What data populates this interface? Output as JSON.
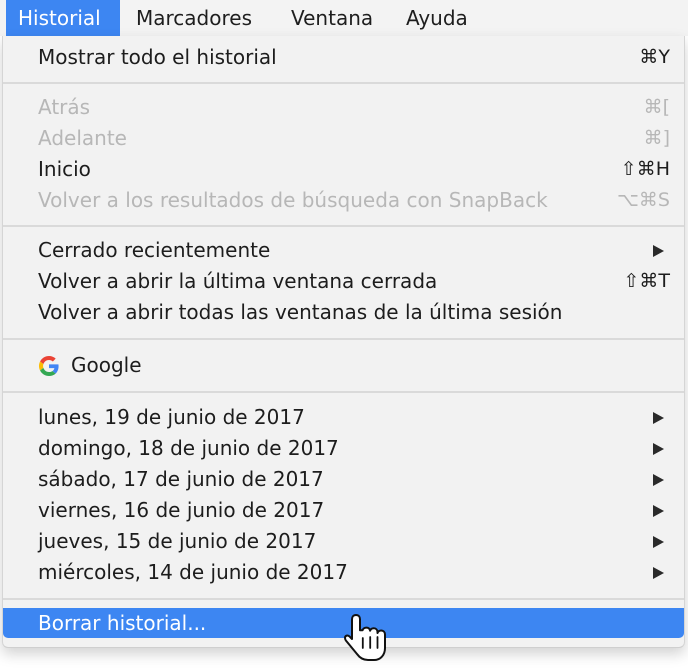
{
  "menubar": {
    "items": [
      "Historial",
      "Marcadores",
      "Ventana",
      "Ayuda"
    ]
  },
  "menu": {
    "show_all": {
      "label": "Mostrar todo el historial",
      "shortcut": "⌘Y"
    },
    "nav": [
      {
        "label": "Atrás",
        "shortcut": "⌘["
      },
      {
        "label": "Adelante",
        "shortcut": "⌘]"
      },
      {
        "label": "Inicio",
        "shortcut": "⇧⌘H"
      },
      {
        "label": "Volver a los resultados de búsqueda con SnapBack",
        "shortcut": "⌥⌘S"
      }
    ],
    "recent": {
      "recently_closed": "Cerrado recientemente",
      "reopen_last_window": "Volver a abrir la última ventana cerrada",
      "reopen_last_window_shortcut": "⇧⌘T",
      "reopen_all_windows": "Volver a abrir todas las ventanas de la última sesión"
    },
    "google": {
      "label": "Google",
      "icon": "google-g-icon"
    },
    "days": [
      "lunes, 19 de junio de 2017",
      "domingo, 18 de junio de 2017",
      "sábado, 17 de junio de 2017",
      "viernes, 16 de junio de 2017",
      "jueves, 15 de junio de 2017",
      "miércoles, 14 de junio de 2017"
    ],
    "clear_history": "Borrar historial..."
  },
  "colors": {
    "accent": "#3d86f2",
    "menu_bg": "#f2f2f2",
    "disabled_text": "#b7b7b7"
  }
}
